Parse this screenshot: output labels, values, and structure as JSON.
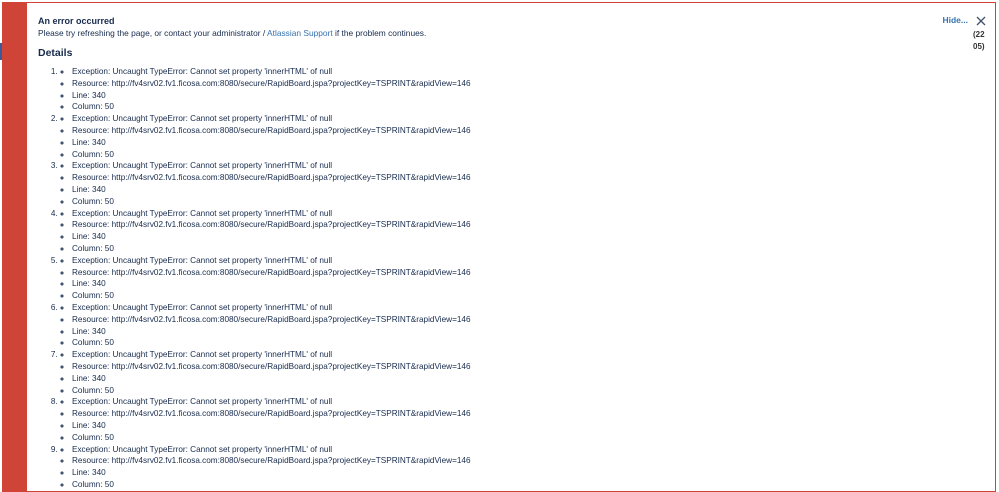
{
  "flag": {
    "title": "An error occurred",
    "message_prefix": "Please try refreshing the page, or contact your administrator / ",
    "support_link": "Atlassian Support",
    "message_suffix": " if the problem continues.",
    "hide_label": "Hide...",
    "count_label": "(2205)",
    "colors": {
      "error": "#d04437",
      "link": "#3572b0"
    }
  },
  "details": {
    "heading": "Details",
    "errors": [
      {
        "exception": "Exception: Uncaught TypeError: Cannot set property 'innerHTML' of null",
        "resource": "Resource: http://fv4srv02.fv1.ficosa.com:8080/secure/RapidBoard.jspa?projectKey=TSPRINT&rapidView=146",
        "line": "Line: 340",
        "column": "Column: 50"
      },
      {
        "exception": "Exception: Uncaught TypeError: Cannot set property 'innerHTML' of null",
        "resource": "Resource: http://fv4srv02.fv1.ficosa.com:8080/secure/RapidBoard.jspa?projectKey=TSPRINT&rapidView=146",
        "line": "Line: 340",
        "column": "Column: 50"
      },
      {
        "exception": "Exception: Uncaught TypeError: Cannot set property 'innerHTML' of null",
        "resource": "Resource: http://fv4srv02.fv1.ficosa.com:8080/secure/RapidBoard.jspa?projectKey=TSPRINT&rapidView=146",
        "line": "Line: 340",
        "column": "Column: 50"
      },
      {
        "exception": "Exception: Uncaught TypeError: Cannot set property 'innerHTML' of null",
        "resource": "Resource: http://fv4srv02.fv1.ficosa.com:8080/secure/RapidBoard.jspa?projectKey=TSPRINT&rapidView=146",
        "line": "Line: 340",
        "column": "Column: 50"
      },
      {
        "exception": "Exception: Uncaught TypeError: Cannot set property 'innerHTML' of null",
        "resource": "Resource: http://fv4srv02.fv1.ficosa.com:8080/secure/RapidBoard.jspa?projectKey=TSPRINT&rapidView=146",
        "line": "Line: 340",
        "column": "Column: 50"
      },
      {
        "exception": "Exception: Uncaught TypeError: Cannot set property 'innerHTML' of null",
        "resource": "Resource: http://fv4srv02.fv1.ficosa.com:8080/secure/RapidBoard.jspa?projectKey=TSPRINT&rapidView=146",
        "line": "Line: 340",
        "column": "Column: 50"
      },
      {
        "exception": "Exception: Uncaught TypeError: Cannot set property 'innerHTML' of null",
        "resource": "Resource: http://fv4srv02.fv1.ficosa.com:8080/secure/RapidBoard.jspa?projectKey=TSPRINT&rapidView=146",
        "line": "Line: 340",
        "column": "Column: 50"
      },
      {
        "exception": "Exception: Uncaught TypeError: Cannot set property 'innerHTML' of null",
        "resource": "Resource: http://fv4srv02.fv1.ficosa.com:8080/secure/RapidBoard.jspa?projectKey=TSPRINT&rapidView=146",
        "line": "Line: 340",
        "column": "Column: 50"
      },
      {
        "exception": "Exception: Uncaught TypeError: Cannot set property 'innerHTML' of null",
        "resource": "Resource: http://fv4srv02.fv1.ficosa.com:8080/secure/RapidBoard.jspa?projectKey=TSPRINT&rapidView=146",
        "line": "Line: 340",
        "column": "Column: 50"
      }
    ]
  }
}
